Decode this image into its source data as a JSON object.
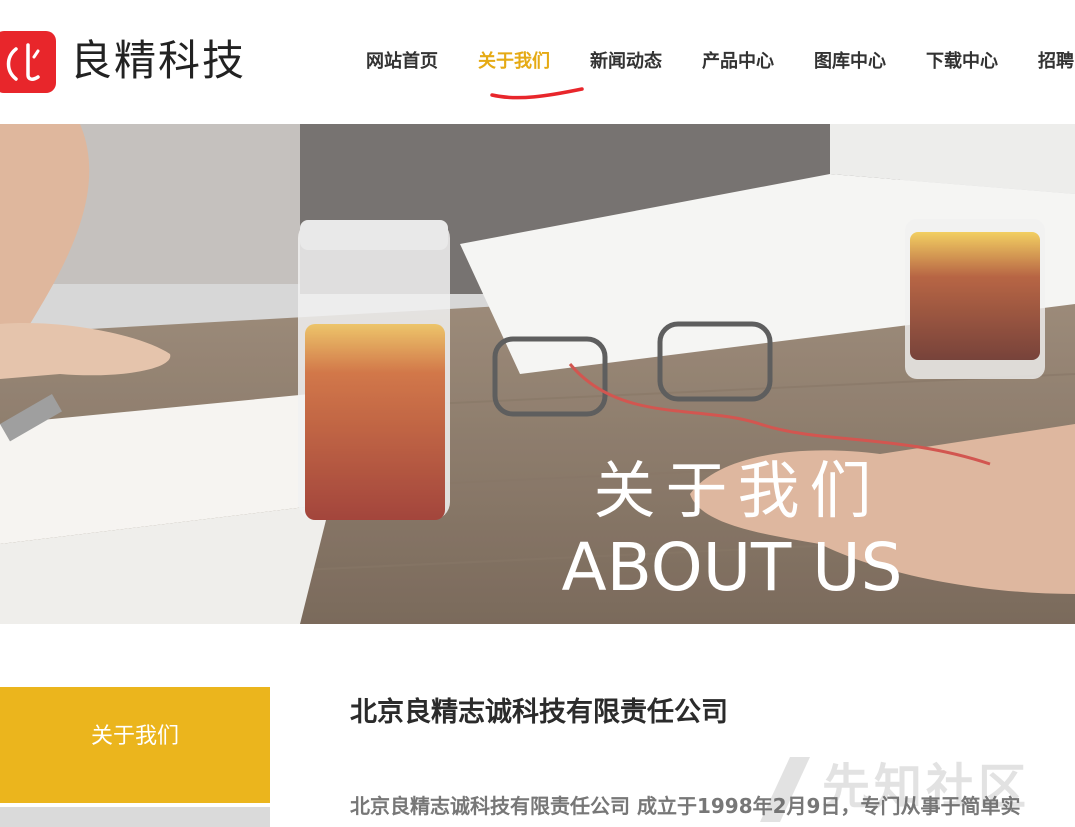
{
  "brand": {
    "name": "良精科技",
    "logo_glyph": "(丨)",
    "logo_color": "#e8262b"
  },
  "nav": {
    "items": [
      {
        "label": "网站首页"
      },
      {
        "label": "关于我们",
        "active": true
      },
      {
        "label": "新闻动态"
      },
      {
        "label": "产品中心"
      },
      {
        "label": "图库中心"
      },
      {
        "label": "下载中心"
      },
      {
        "label": "招聘中心"
      }
    ],
    "active_color": "#e5aa14"
  },
  "banner": {
    "title_cn": "关于我们",
    "title_en": "ABOUT US"
  },
  "sidebar": {
    "active_label": "关于我们",
    "active_color": "#ebb51d"
  },
  "content": {
    "company_title": "北京良精志诚科技有限责任公司",
    "intro": "北京良精志诚科技有限责任公司 成立于1998年2月9日，专门从事于简单实"
  },
  "watermark": {
    "text": "先知社区"
  }
}
